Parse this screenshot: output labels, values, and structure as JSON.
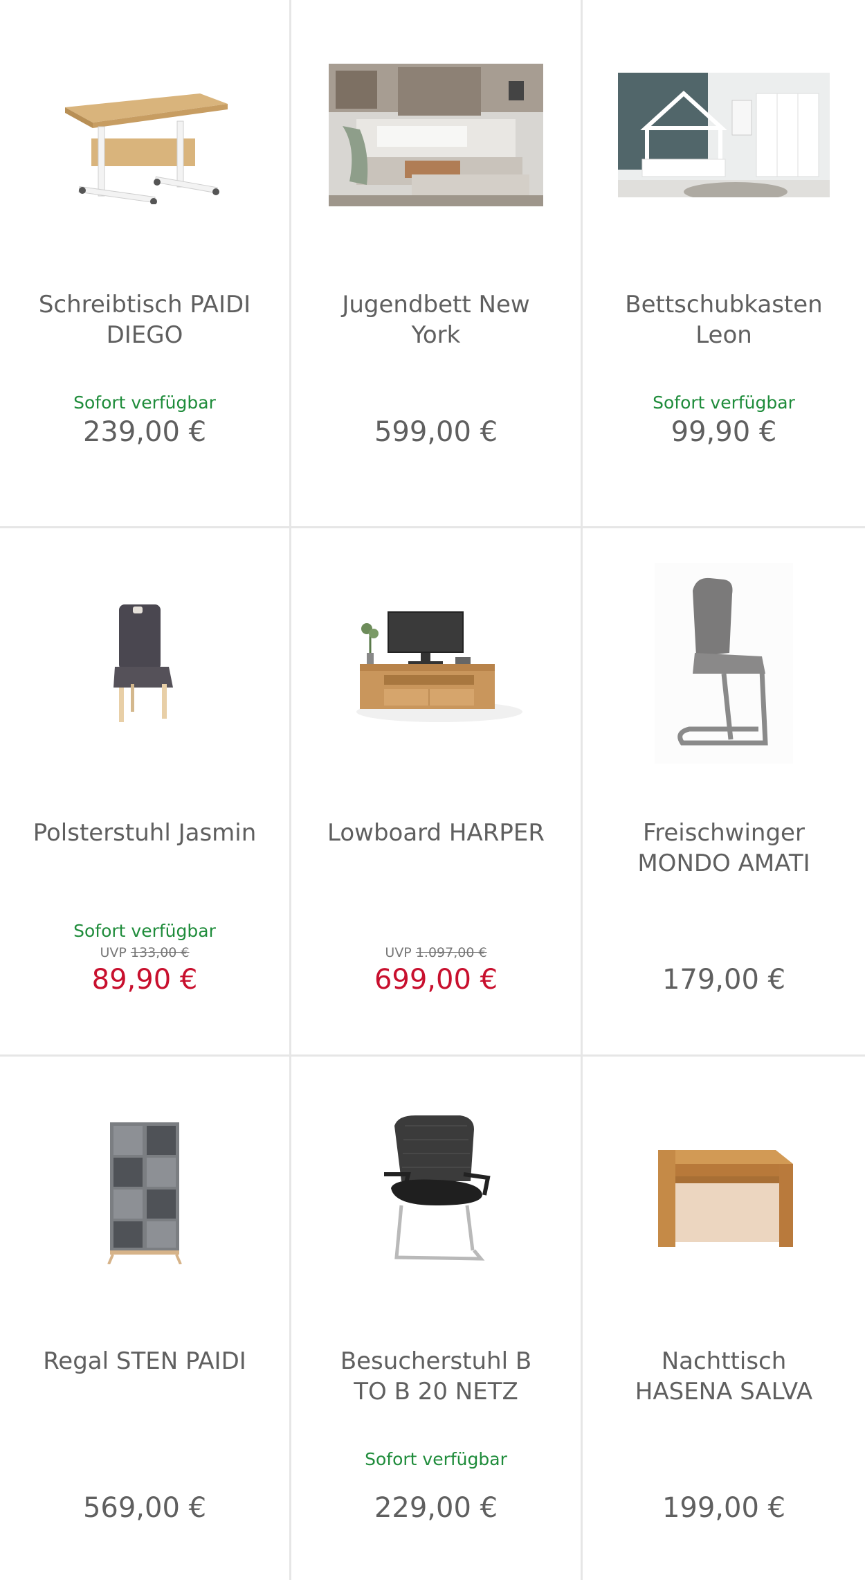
{
  "products": [
    {
      "title": "Schreibtisch PAIDI DIEGO",
      "availability": "Sofort verfügbar",
      "uvp_label": "",
      "uvp_price": "",
      "price": "239,00 €",
      "sale": false
    },
    {
      "title": "Jugendbett New York",
      "availability": "",
      "uvp_label": "",
      "uvp_price": "",
      "price": "599,00 €",
      "sale": false
    },
    {
      "title": "Bettschubkasten Leon",
      "availability": "Sofort verfügbar",
      "uvp_label": "",
      "uvp_price": "",
      "price": "99,90 €",
      "sale": false
    },
    {
      "title": "Polsterstuhl Jasmin",
      "availability": "Sofort verfügbar",
      "uvp_label": "UVP",
      "uvp_price": "133,00 €",
      "price": "89,90 €",
      "sale": true
    },
    {
      "title": "Lowboard HARPER",
      "availability": "",
      "uvp_label": "UVP",
      "uvp_price": "1.097,00 €",
      "price": "699,00 €",
      "sale": true
    },
    {
      "title": "Freischwinger MONDO AMATI",
      "availability": "",
      "uvp_label": "",
      "uvp_price": "",
      "price": "179,00 €",
      "sale": false
    },
    {
      "title": "Regal STEN PAIDI",
      "availability": "",
      "uvp_label": "",
      "uvp_price": "",
      "price": "569,00 €",
      "sale": false
    },
    {
      "title": "Besucherstuhl B TO B 20 NETZ",
      "availability": "Sofort verfügbar",
      "uvp_label": "",
      "uvp_price": "",
      "price": "229,00 €",
      "sale": false
    },
    {
      "title": "Nachttisch HASENA SALVA",
      "availability": "",
      "uvp_label": "",
      "uvp_price": "",
      "price": "199,00 €",
      "sale": false
    }
  ],
  "icons": [
    "desk-image-icon",
    "bed-image-icon",
    "house-bed-image-icon",
    "chair-image-icon",
    "lowboard-image-icon",
    "cantilever-chair-image-icon",
    "shelf-image-icon",
    "visitor-chair-image-icon",
    "nightstand-image-icon"
  ],
  "colors": {
    "availability": "#1f8c3b",
    "sale_price": "#c8102e",
    "price": "#5f5f5f",
    "divider": "#e6e6e6"
  }
}
